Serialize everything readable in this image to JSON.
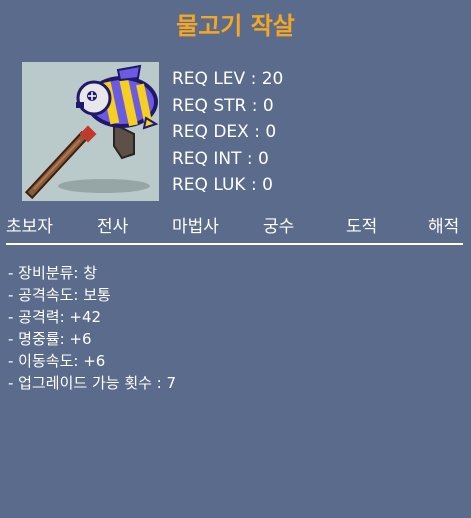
{
  "item": {
    "name": "물고기 작살",
    "icon": "fish-harpoon-icon"
  },
  "requirements": [
    "REQ LEV : 20",
    "REQ STR : 0",
    "REQ DEX : 0",
    "REQ INT : 0",
    "REQ LUK : 0"
  ],
  "jobs": [
    "초보자",
    "전사",
    "마법사",
    "궁수",
    "도적",
    "해적"
  ],
  "stats": [
    "- 장비분류: 창",
    "- 공격속도: 보통",
    "- 공격력: +42",
    "- 명중률: +6",
    "- 이동속도: +6",
    "- 업그레이드 가능 횟수 : 7"
  ],
  "colors": {
    "background": "#5b6b8b",
    "title": "#f5a623",
    "text": "#ffffff"
  }
}
